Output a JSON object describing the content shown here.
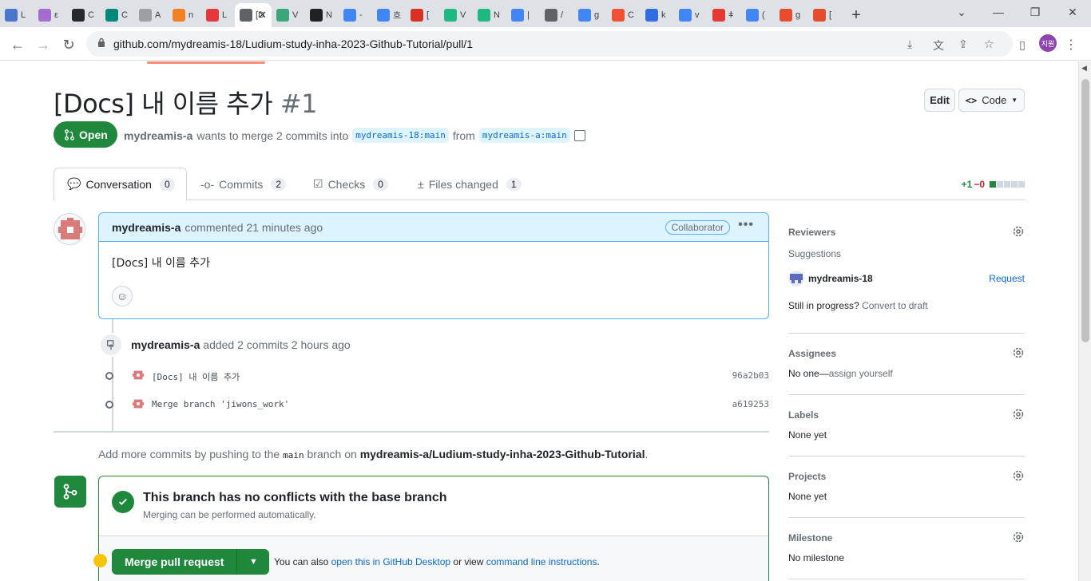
{
  "browser": {
    "tabs": [
      {
        "icon": "book-icon",
        "label": "L",
        "color": "#4a76c9"
      },
      {
        "icon": "image-icon",
        "label": "ε",
        "color": "#a56ccf"
      },
      {
        "icon": "github-icon",
        "label": "C",
        "color": "#24292f"
      },
      {
        "icon": "meet-icon",
        "label": "C",
        "color": "#00897b"
      },
      {
        "icon": "notion-ai-icon",
        "label": "A",
        "color": "#9aa0a6"
      },
      {
        "icon": "stackoverflow-icon",
        "label": "n",
        "color": "#f48024"
      },
      {
        "icon": "heart-icon",
        "label": "L",
        "color": "#e5383b"
      },
      {
        "icon": "page-icon",
        "label": "[D",
        "color": "#5f6368",
        "active": true
      },
      {
        "icon": "notion-n-icon",
        "label": "V",
        "color": "#3aa67a"
      },
      {
        "icon": "notion-icon",
        "label": "N",
        "color": "#202124"
      },
      {
        "icon": "google-icon",
        "label": "-",
        "color": "#4285f4"
      },
      {
        "icon": "google-icon",
        "label": "흐",
        "color": "#4285f4"
      },
      {
        "icon": "gmail-icon",
        "label": "[",
        "color": "#d93025"
      },
      {
        "icon": "vuetify-icon",
        "label": "V",
        "color": "#1eb980"
      },
      {
        "icon": "vuetify-icon",
        "label": "N",
        "color": "#1eb980"
      },
      {
        "icon": "google-icon",
        "label": "|",
        "color": "#4285f4"
      },
      {
        "icon": "chrome-icon",
        "label": "/",
        "color": "#5f6368"
      },
      {
        "icon": "google-icon",
        "label": "g",
        "color": "#4285f4"
      },
      {
        "icon": "git-icon",
        "label": "C",
        "color": "#f05133"
      },
      {
        "icon": "kubernetes-icon",
        "label": "k",
        "color": "#326ce5"
      },
      {
        "icon": "google-icon",
        "label": "v",
        "color": "#4285f4"
      },
      {
        "icon": "d-icon",
        "label": "ǂ",
        "color": "#e53935"
      },
      {
        "icon": "google-icon",
        "label": "(",
        "color": "#4285f4"
      },
      {
        "icon": "brave-icon",
        "label": "g",
        "color": "#e54d2e"
      },
      {
        "icon": "brave-icon",
        "label": "[",
        "color": "#e54d2e"
      }
    ],
    "active_tab_close": "✕",
    "new_tab": "+",
    "url": "github.com/mydreamis-18/Ludium-study-inha-2023-Github-Tutorial/pull/1",
    "profile_initials": "지원"
  },
  "pr": {
    "title": "[Docs] 내 이름 추가",
    "number": "#1",
    "edit_label": "Edit",
    "code_label": "Code",
    "state": "Open",
    "author": "mydreamis-a",
    "merge_text": "wants to merge 2 commits into",
    "base_branch": "mydreamis-18:main",
    "from_text": "from",
    "head_branch": "mydreamis-a:main"
  },
  "tabs": [
    {
      "label": "Conversation",
      "count": "0"
    },
    {
      "label": "Commits",
      "count": "2"
    },
    {
      "label": "Checks",
      "count": "0"
    },
    {
      "label": "Files changed",
      "count": "1"
    }
  ],
  "diffstat": {
    "additions": "+1",
    "deletions": "−0",
    "colors": [
      "#1f883d",
      "#d0d7de",
      "#d0d7de",
      "#d0d7de",
      "#d0d7de"
    ]
  },
  "comment": {
    "author": "mydreamis-a",
    "time": "commented 21 minutes ago",
    "badge": "Collaborator",
    "body": "[Docs] 내 이름 추가"
  },
  "event": {
    "author": "mydreamis-a",
    "text": "added 2 commits 2 hours ago",
    "commits": [
      {
        "message": "[Docs] 내 이름 추가",
        "sha": "96a2b03"
      },
      {
        "message": "Merge branch 'jiwons_work'",
        "sha": "a619253"
      }
    ]
  },
  "add_more": {
    "prefix": "Add more commits by pushing to the",
    "branch": "main",
    "middle": "branch on",
    "repo": "mydreamis-a/Ludium-study-inha-2023-Github-Tutorial",
    "suffix": "."
  },
  "merge": {
    "title": "This branch has no conflicts with the base branch",
    "subtitle": "Merging can be performed automatically.",
    "button": "Merge pull request",
    "also_prefix": "You can also",
    "desktop_link": "open this in GitHub Desktop",
    "or_view": "or view",
    "cli_link": "command line instructions",
    "period": "."
  },
  "sidebar": {
    "reviewers": {
      "heading": "Reviewers",
      "suggestions": "Suggestions",
      "user": "mydreamis-18",
      "request": "Request",
      "progress": "Still in progress?",
      "convert": "Convert to draft"
    },
    "assignees": {
      "heading": "Assignees",
      "none": "No one—",
      "assign": "assign yourself"
    },
    "labels": {
      "heading": "Labels",
      "value": "None yet"
    },
    "projects": {
      "heading": "Projects",
      "value": "None yet"
    },
    "milestone": {
      "heading": "Milestone",
      "value": "No milestone"
    }
  }
}
